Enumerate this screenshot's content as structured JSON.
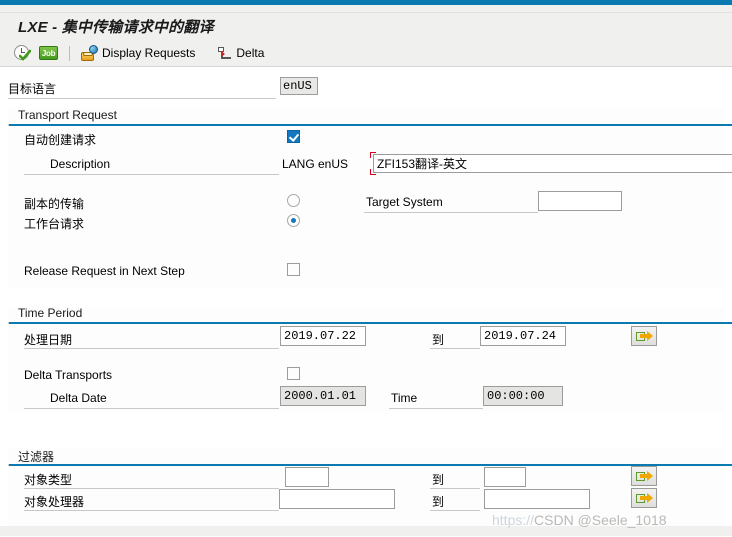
{
  "window": {
    "title": "LXE - 集中传输请求中的翻译",
    "accent_color": "#0a7ab0",
    "header_bg": "#f0f0ef"
  },
  "toolbar": {
    "execute_icon": "clock-check-execute-icon",
    "job_icon": "job-badge-icon",
    "job_label": "Job",
    "display_requests_icon": "display-requests-icon",
    "display_requests_label": "Display Requests",
    "delta_icon": "delta-axes-icon",
    "delta_label": "Delta"
  },
  "target_language": {
    "label": "目标语言",
    "value": "enUS"
  },
  "transport_request": {
    "group_title": "Transport Request",
    "auto_create": {
      "label": "自动创建请求",
      "checked": true
    },
    "description": {
      "label": "Description",
      "lang_label": "LANG enUS",
      "value": "ZFI153翻译-英文",
      "focused": true,
      "focus_color": "#d0021b"
    },
    "copy_transport": {
      "label": "副本的传输",
      "selected": false
    },
    "workbench_request": {
      "label": "工作台请求",
      "selected": true
    },
    "target_system": {
      "label": "Target System",
      "value": ""
    },
    "release_next_step": {
      "label": "Release Request in Next Step",
      "checked": false
    }
  },
  "time_period": {
    "group_title": "Time Period",
    "process_date": {
      "label": "处理日期",
      "from": "2019.07.22",
      "to_label": "到",
      "to": "2019.07.24",
      "multi_select_icon": "multiple-selection-arrow-icon"
    },
    "delta_transports": {
      "label": "Delta Transports",
      "checked": false
    },
    "delta_date": {
      "label": "Delta Date",
      "value": "2000.01.01",
      "disabled": true
    },
    "time": {
      "label": "Time",
      "value": "00:00:00",
      "disabled": true
    }
  },
  "filter": {
    "group_title": "过滤器",
    "object_type": {
      "label": "对象类型",
      "from": "",
      "to_label": "到",
      "to": "",
      "multi_select_icon": "multiple-selection-arrow-icon"
    },
    "object_processor": {
      "label": "对象处理器",
      "from": "",
      "to_label": "到",
      "to": "",
      "multi_select_icon": "multiple-selection-arrow-icon"
    }
  },
  "watermark": {
    "url_text": "https://",
    "text": "CSDN @Seele_1018"
  }
}
